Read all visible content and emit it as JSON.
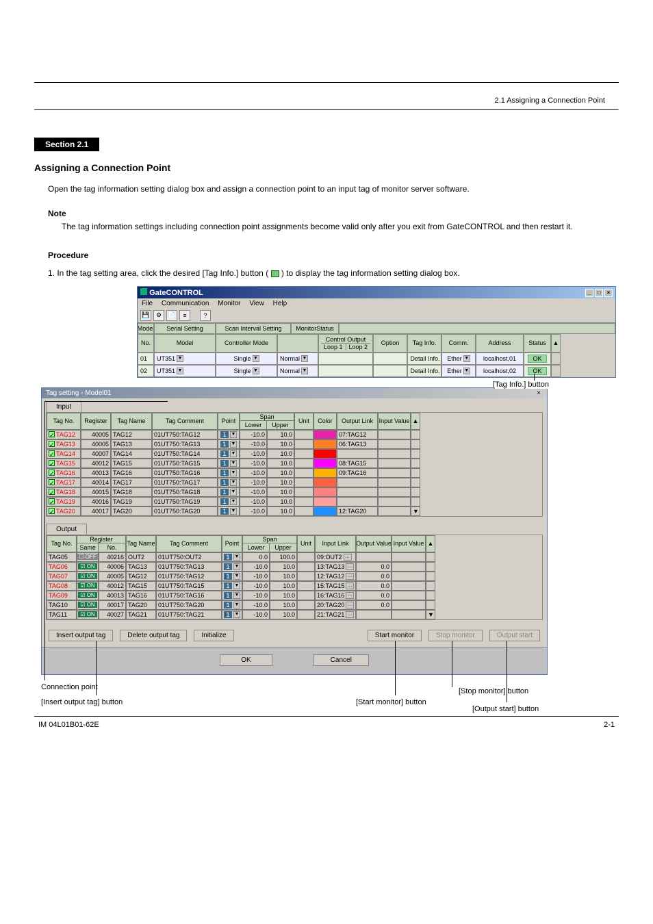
{
  "header": {
    "right_small": "2.1 Assigning a Connection Point"
  },
  "section": {
    "label": "Section 2.1",
    "title": "Assigning a Connection Point"
  },
  "para1": "Open the tag information setting dialog box and assign a connection point to an input tag of monitor server software.",
  "note_label": "Note",
  "note_body": "The tag information settings including connection point assignments become valid only after you exit from GateCONTROL and then restart it.",
  "procedure": "Procedure",
  "step1_a": "1. In the tag setting area, click the desired [Tag Info.] button (",
  "step1_b": ") to display the tag information setting dialog box.",
  "gatecontrol": {
    "title": "GateCONTROL",
    "menus": [
      "File",
      "Communication",
      "Monitor",
      "View",
      "Help"
    ],
    "head": {
      "model": "Model",
      "no": "No.",
      "serial": "Serial Setting",
      "scan": "Scan Interval Setting",
      "cm": "Controller Mode",
      "ms": "MonitorStatus",
      "co": "Control Output",
      "loop1": "Loop 1",
      "loop2": "Loop 2",
      "option": "Option",
      "taginfo": "Tag Info.",
      "comm": "Comm.",
      "addr": "Address",
      "status": "Status"
    },
    "rows": [
      {
        "no": "01",
        "model": "UT351",
        "cm": "Single",
        "ms": "Normal",
        "taginfo_btn": "Detail Info.",
        "comm": "Ether",
        "addr": "localhost,01",
        "status": "OK"
      },
      {
        "no": "02",
        "model": "UT351",
        "cm": "Single",
        "ms": "Normal",
        "taginfo_btn": "Detail Info.",
        "comm": "Ether",
        "addr": "localhost,02",
        "status": "OK"
      }
    ]
  },
  "tagdialog": {
    "title": "Tag setting - Model01",
    "tab_input": "Input",
    "tab_output": "Output",
    "ihead": {
      "tag": "Tag No.",
      "reg": "Register",
      "name": "Tag Name",
      "com": "Tag Comment",
      "point": "Point",
      "span": "Span",
      "lower": "Lower",
      "upper": "Upper",
      "unit": "Unit",
      "color": "Color",
      "outlink": "Output Link",
      "ival": "Input Value"
    },
    "irows": [
      {
        "tag": "TAG12",
        "reg": "40005",
        "name": "TAG12",
        "com": "01UT750:TAG12",
        "pt": "1",
        "lo": "-10.0",
        "hi": "10.0",
        "color": "#e524a6",
        "outlink": "07:TAG12"
      },
      {
        "tag": "TAG13",
        "reg": "40005",
        "name": "TAG13",
        "com": "01UT750:TAG13",
        "pt": "1",
        "lo": "-10.0",
        "hi": "10.0",
        "color": "#ff7f27",
        "outlink": "06:TAG13"
      },
      {
        "tag": "TAG14",
        "reg": "40007",
        "name": "TAG14",
        "com": "01UT750:TAG14",
        "pt": "1",
        "lo": "-10.0",
        "hi": "10.0",
        "color": "#ff0000",
        "outlink": ""
      },
      {
        "tag": "TAG15",
        "reg": "40012",
        "name": "TAG15",
        "com": "01UT750:TAG15",
        "pt": "1",
        "lo": "-10.0",
        "hi": "10.0",
        "color": "#ff00ff",
        "outlink": "08:TAG15"
      },
      {
        "tag": "TAG16",
        "reg": "40013",
        "name": "TAG16",
        "com": "01UT750:TAG16",
        "pt": "1",
        "lo": "-10.0",
        "hi": "10.0",
        "color": "#ffb000",
        "outlink": "09:TAG16"
      },
      {
        "tag": "TAG17",
        "reg": "40014",
        "name": "TAG17",
        "com": "01UT750:TAG17",
        "pt": "1",
        "lo": "-10.0",
        "hi": "10.0",
        "color": "#ff6040",
        "outlink": ""
      },
      {
        "tag": "TAG18",
        "reg": "40015",
        "name": "TAG18",
        "com": "01UT750:TAG18",
        "pt": "1",
        "lo": "-10.0",
        "hi": "10.0",
        "color": "#ff8080",
        "outlink": ""
      },
      {
        "tag": "TAG19",
        "reg": "40016",
        "name": "TAG19",
        "com": "01UT750:TAG19",
        "pt": "1",
        "lo": "-10.0",
        "hi": "10.0",
        "color": "#ffa0a0",
        "outlink": ""
      },
      {
        "tag": "TAG20",
        "reg": "40017",
        "name": "TAG20",
        "com": "01UT750:TAG20",
        "pt": "1",
        "lo": "-10.0",
        "hi": "10.0",
        "color": "#1e90ff",
        "outlink": "12:TAG20"
      }
    ],
    "ohead": {
      "tag": "Tag No.",
      "reg": "Register",
      "same": "Same",
      "no": "No.",
      "name": "Tag Name",
      "com": "Tag Comment",
      "point": "Point",
      "span": "Span",
      "lower": "Lower",
      "upper": "Upper",
      "unit": "Unit",
      "ilink": "Input Link",
      "oval": "Output Value",
      "ival": "Input Value"
    },
    "orows": [
      {
        "tag": "TAG05",
        "same": "OFF",
        "no": "40216",
        "name": "OUT2",
        "com": "01UT750:OUT2",
        "pt": "1",
        "lo": "0.0",
        "hi": "100.0",
        "link": "09:OUT2",
        "ov": ""
      },
      {
        "tag": "TAG06",
        "same": "ON",
        "no": "40006",
        "name": "TAG13",
        "com": "01UT750:TAG13",
        "pt": "1",
        "lo": "-10.0",
        "hi": "10.0",
        "link": "13:TAG13",
        "ov": "0.0"
      },
      {
        "tag": "TAG07",
        "same": "ON",
        "no": "40005",
        "name": "TAG12",
        "com": "01UT750:TAG12",
        "pt": "1",
        "lo": "-10.0",
        "hi": "10.0",
        "link": "12:TAG12",
        "ov": "0.0"
      },
      {
        "tag": "TAG08",
        "same": "ON",
        "no": "40012",
        "name": "TAG15",
        "com": "01UT750:TAG15",
        "pt": "1",
        "lo": "-10.0",
        "hi": "10.0",
        "link": "15:TAG15",
        "ov": "0.0"
      },
      {
        "tag": "TAG09",
        "same": "ON",
        "no": "40013",
        "name": "TAG16",
        "com": "01UT750:TAG16",
        "pt": "1",
        "lo": "-10.0",
        "hi": "10.0",
        "link": "16:TAG16",
        "ov": "0.0"
      },
      {
        "tag": "TAG10",
        "same": "ON",
        "no": "40017",
        "name": "TAG20",
        "com": "01UT750:TAG20",
        "pt": "1",
        "lo": "-10.0",
        "hi": "10.0",
        "link": "20:TAG20",
        "ov": "0.0"
      },
      {
        "tag": "TAG11",
        "same": "ON",
        "no": "40027",
        "name": "TAG21",
        "com": "01UT750:TAG21",
        "pt": "1",
        "lo": "-10.0",
        "hi": "10.0",
        "link": "21:TAG21",
        "ov": ""
      }
    ],
    "buttons": {
      "insert": "Insert output tag",
      "delete": "Delete output tag",
      "init": "Initialize",
      "start": "Start monitor",
      "stop": "Stop monitor",
      "output": "Output start",
      "ok": "OK",
      "cancel": "Cancel"
    }
  },
  "callouts": {
    "connection": "Connection point",
    "taginfobtn": "[Tag Info.] button",
    "startmon": "[Start monitor] button",
    "stopmon": "[Stop monitor] button",
    "inserttag": "[Insert output tag] button",
    "outstart": "[Output start] button"
  },
  "footer": {
    "left": "IM 04L01B01-62E",
    "right": "2-1"
  }
}
